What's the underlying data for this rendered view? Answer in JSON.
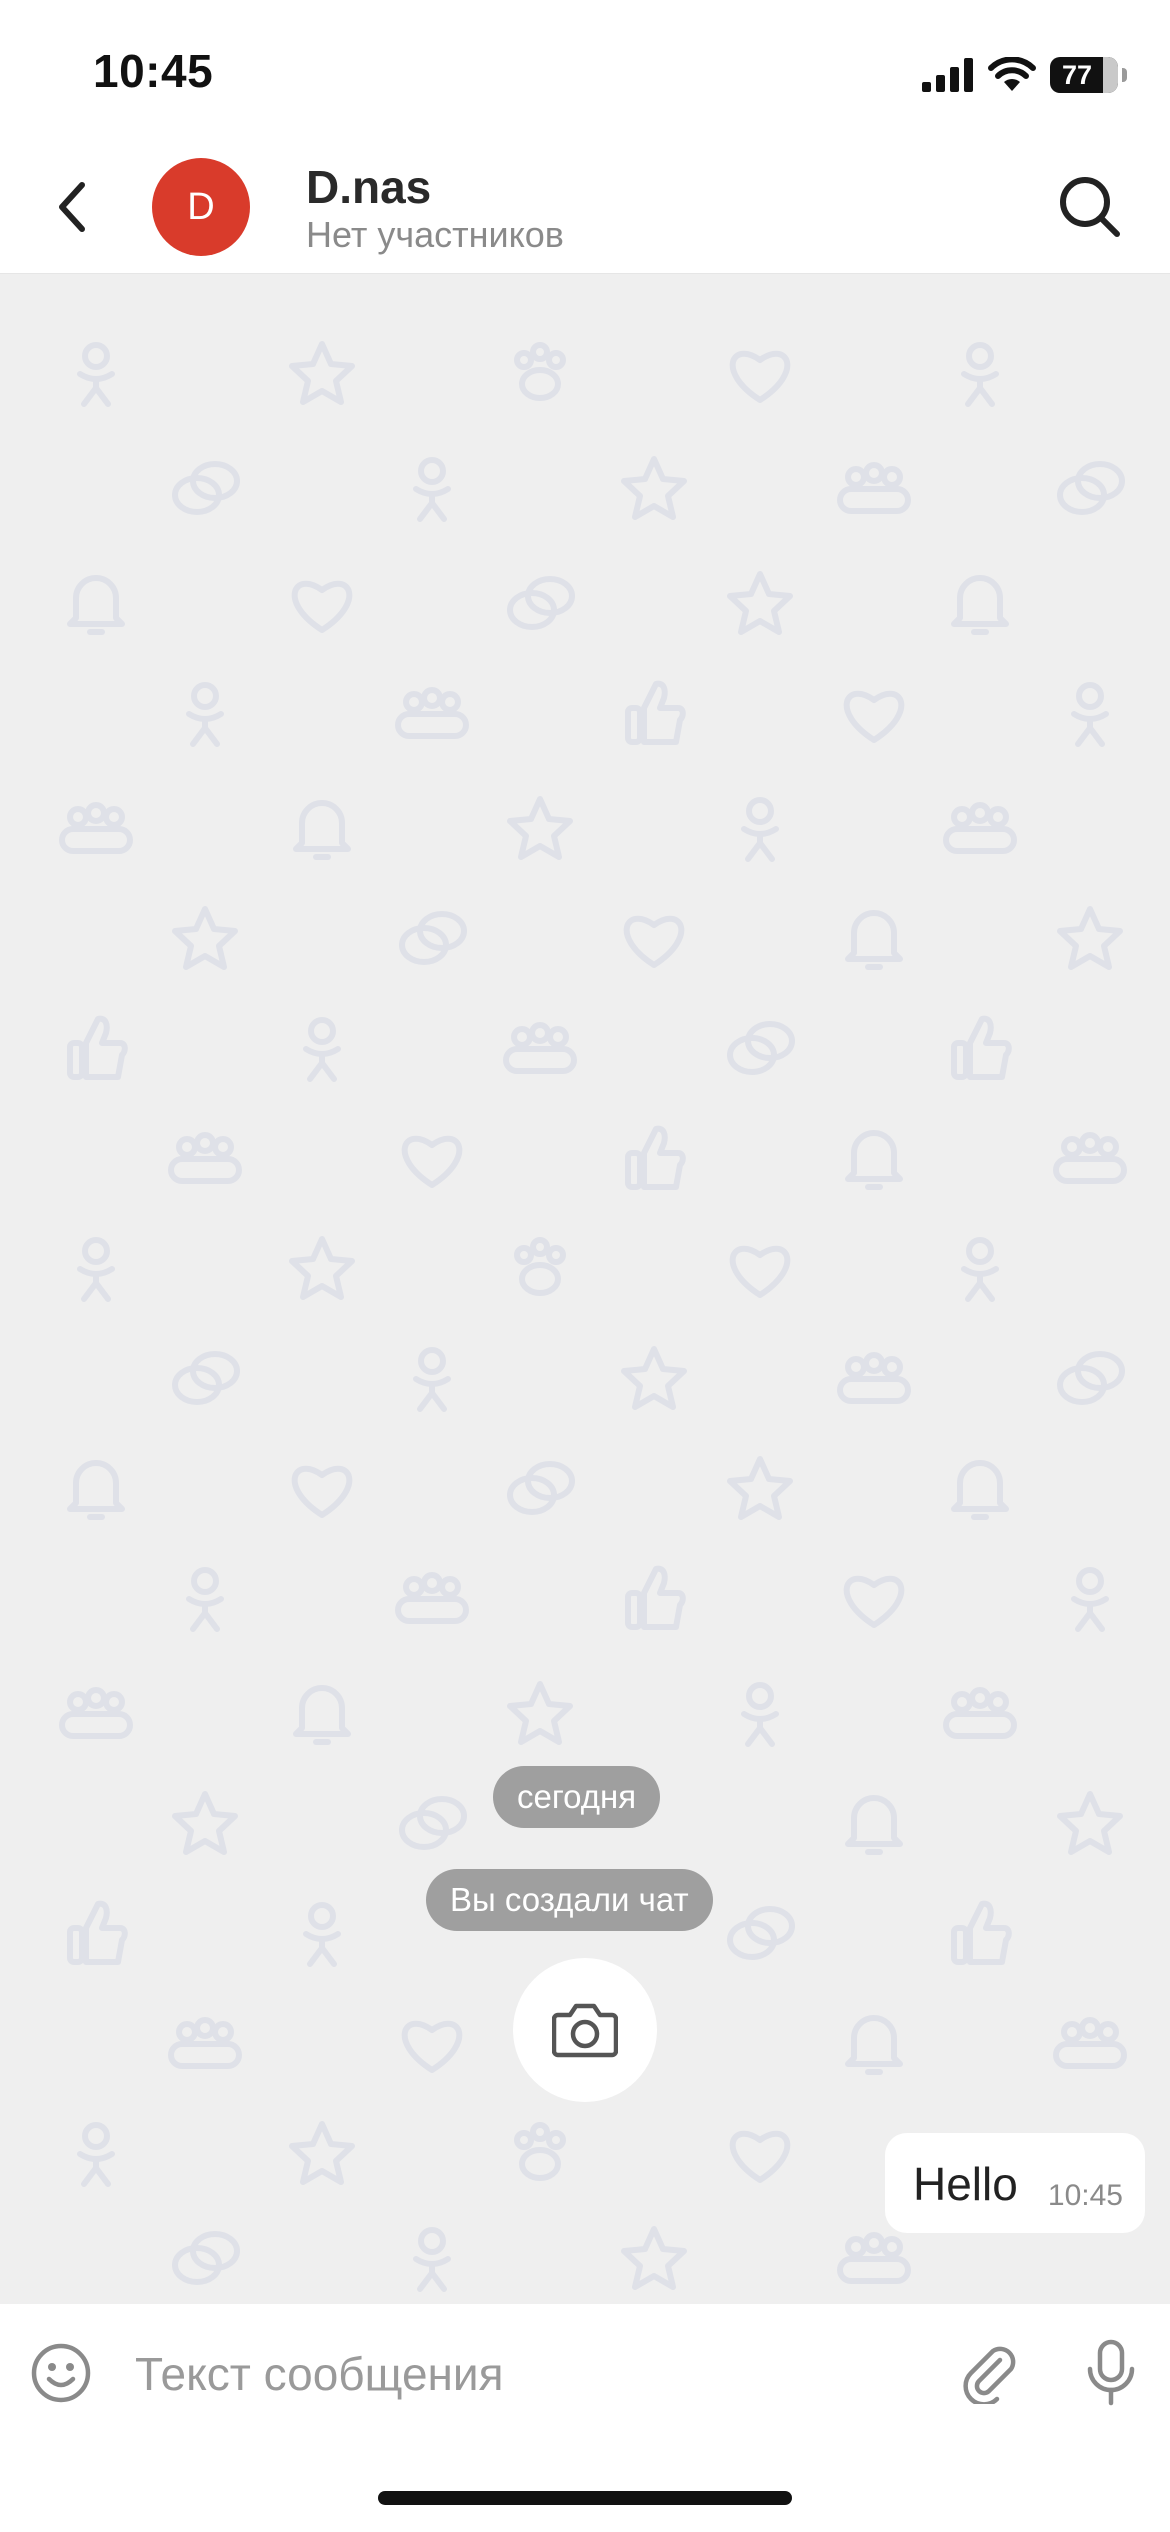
{
  "status_bar": {
    "time": "10:45",
    "battery_percent": "77",
    "icons": [
      "signal-icon",
      "wifi-icon",
      "battery-icon"
    ]
  },
  "header": {
    "back_icon": "chevron-left-icon",
    "avatar_letter": "D",
    "avatar_color": "#d93b2b",
    "title": "D.nas",
    "subtitle": "Нет участников",
    "search_icon": "search-icon"
  },
  "chat": {
    "background_color": "#efefef",
    "wallpaper_icons": [
      "person-icon",
      "star-icon",
      "paw-icon",
      "heart-icon",
      "chat-bubbles-icon",
      "group-icon",
      "bell-icon",
      "thumbs-up-icon"
    ],
    "date_label": "сегодня",
    "system_message": "Вы создали чат",
    "camera_icon": "camera-icon",
    "messages": [
      {
        "text": "Hello",
        "time": "10:45",
        "outgoing": true
      }
    ]
  },
  "input_bar": {
    "placeholder": "Текст сообщения",
    "emoji_icon": "emoji-icon",
    "attach_icon": "paperclip-icon",
    "mic_icon": "microphone-icon"
  }
}
